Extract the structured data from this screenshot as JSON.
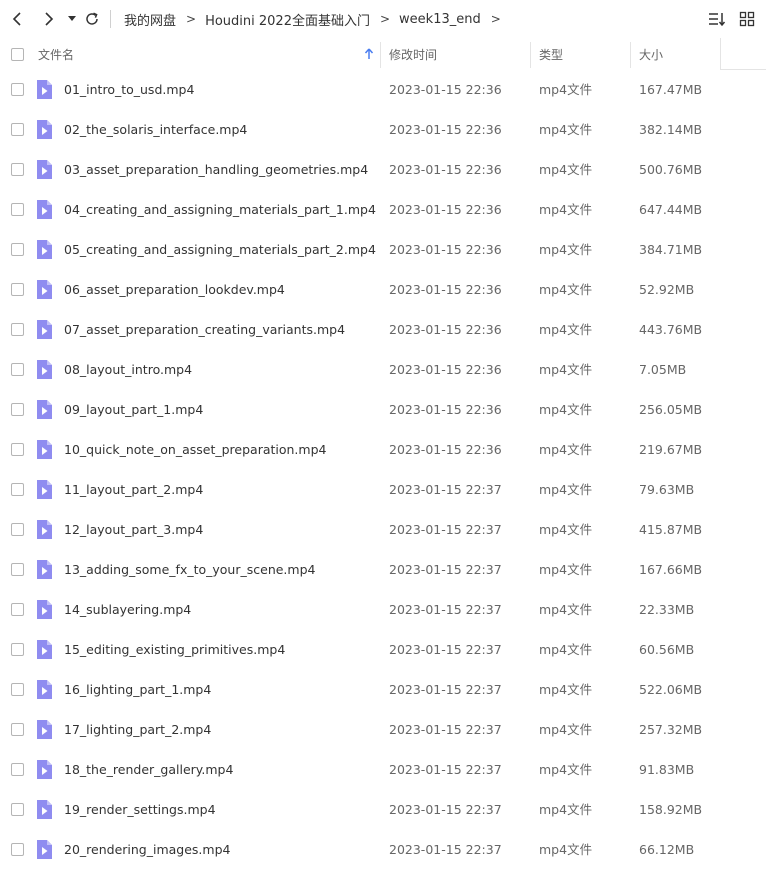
{
  "breadcrumb": [
    "我的网盘",
    "Houdini 2022全面基础入门",
    "week13_end"
  ],
  "breadcrumb_separator": ">",
  "columns": {
    "name": "文件名",
    "modified": "修改时间",
    "type": "类型",
    "size": "大小"
  },
  "icons": {
    "back": "chevron-left-icon",
    "forward": "chevron-right-icon",
    "history": "caret-down-icon",
    "refresh": "refresh-icon",
    "sort": "sort-icon",
    "view": "grid-view-icon",
    "sort_indicator": "arrow-up-icon",
    "file": "video-file-icon"
  },
  "colors": {
    "accent": "#4a7df0",
    "file_icon": "#8f8cf0"
  },
  "files": [
    {
      "name": "01_intro_to_usd.mp4",
      "modified": "2023-01-15 22:36",
      "type": "mp4文件",
      "size": "167.47MB"
    },
    {
      "name": "02_the_solaris_interface.mp4",
      "modified": "2023-01-15 22:36",
      "type": "mp4文件",
      "size": "382.14MB"
    },
    {
      "name": "03_asset_preparation_handling_geometries.mp4",
      "modified": "2023-01-15 22:36",
      "type": "mp4文件",
      "size": "500.76MB"
    },
    {
      "name": "04_creating_and_assigning_materials_part_1.mp4",
      "modified": "2023-01-15 22:36",
      "type": "mp4文件",
      "size": "647.44MB"
    },
    {
      "name": "05_creating_and_assigning_materials_part_2.mp4",
      "modified": "2023-01-15 22:36",
      "type": "mp4文件",
      "size": "384.71MB"
    },
    {
      "name": "06_asset_preparation_lookdev.mp4",
      "modified": "2023-01-15 22:36",
      "type": "mp4文件",
      "size": "52.92MB"
    },
    {
      "name": "07_asset_preparation_creating_variants.mp4",
      "modified": "2023-01-15 22:36",
      "type": "mp4文件",
      "size": "443.76MB"
    },
    {
      "name": "08_layout_intro.mp4",
      "modified": "2023-01-15 22:36",
      "type": "mp4文件",
      "size": "7.05MB"
    },
    {
      "name": "09_layout_part_1.mp4",
      "modified": "2023-01-15 22:36",
      "type": "mp4文件",
      "size": "256.05MB"
    },
    {
      "name": "10_quick_note_on_asset_preparation.mp4",
      "modified": "2023-01-15 22:36",
      "type": "mp4文件",
      "size": "219.67MB"
    },
    {
      "name": "11_layout_part_2.mp4",
      "modified": "2023-01-15 22:37",
      "type": "mp4文件",
      "size": "79.63MB"
    },
    {
      "name": "12_layout_part_3.mp4",
      "modified": "2023-01-15 22:37",
      "type": "mp4文件",
      "size": "415.87MB"
    },
    {
      "name": "13_adding_some_fx_to_your_scene.mp4",
      "modified": "2023-01-15 22:37",
      "type": "mp4文件",
      "size": "167.66MB"
    },
    {
      "name": "14_sublayering.mp4",
      "modified": "2023-01-15 22:37",
      "type": "mp4文件",
      "size": "22.33MB"
    },
    {
      "name": "15_editing_existing_primitives.mp4",
      "modified": "2023-01-15 22:37",
      "type": "mp4文件",
      "size": "60.56MB"
    },
    {
      "name": "16_lighting_part_1.mp4",
      "modified": "2023-01-15 22:37",
      "type": "mp4文件",
      "size": "522.06MB"
    },
    {
      "name": "17_lighting_part_2.mp4",
      "modified": "2023-01-15 22:37",
      "type": "mp4文件",
      "size": "257.32MB"
    },
    {
      "name": "18_the_render_gallery.mp4",
      "modified": "2023-01-15 22:37",
      "type": "mp4文件",
      "size": "91.83MB"
    },
    {
      "name": "19_render_settings.mp4",
      "modified": "2023-01-15 22:37",
      "type": "mp4文件",
      "size": "158.92MB"
    },
    {
      "name": "20_rendering_images.mp4",
      "modified": "2023-01-15 22:37",
      "type": "mp4文件",
      "size": "66.12MB"
    }
  ]
}
